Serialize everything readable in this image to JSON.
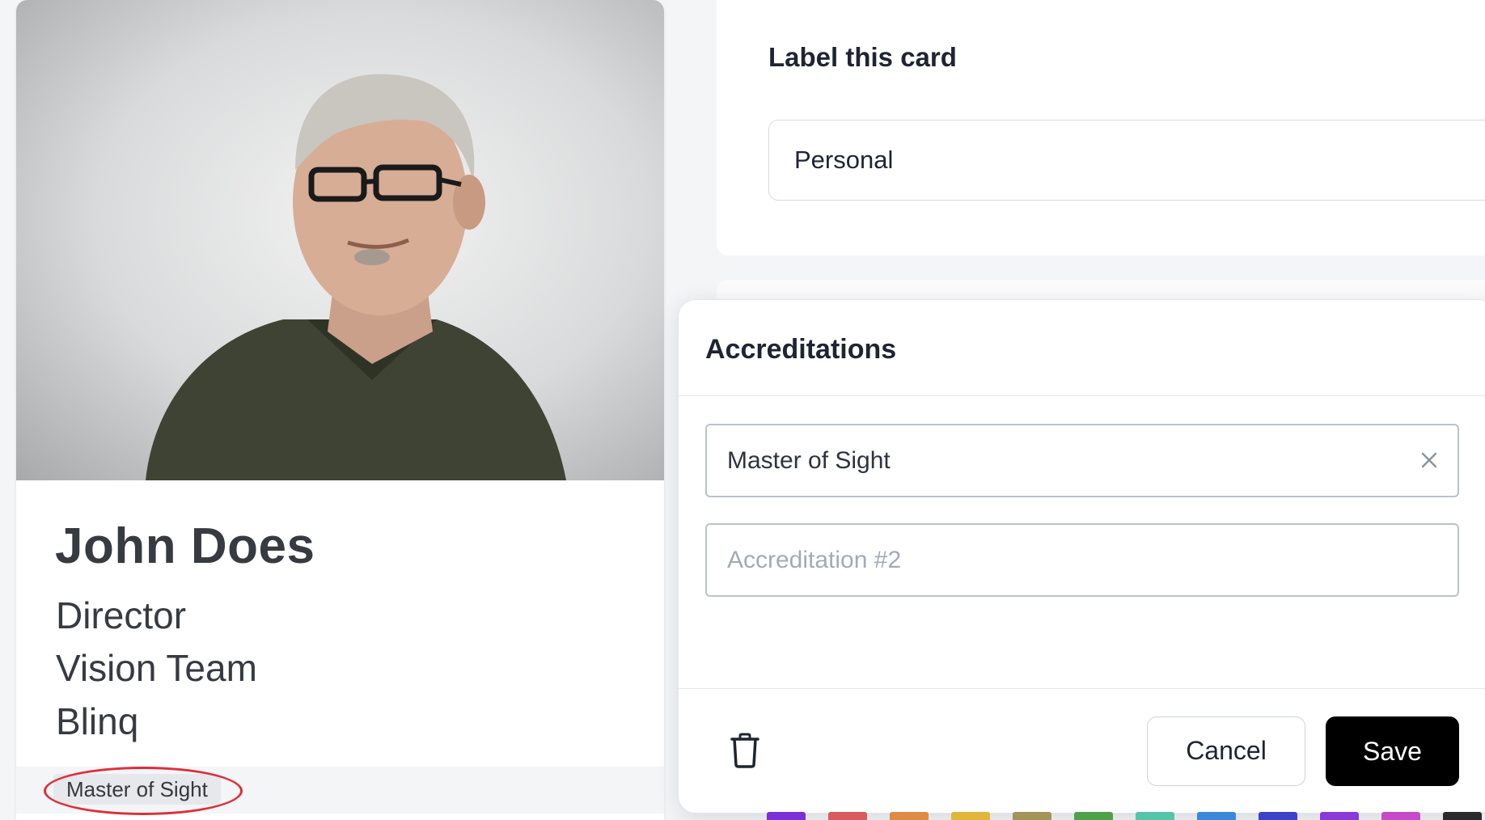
{
  "profile": {
    "name": "John Does",
    "title": "Director",
    "department": "Vision Team",
    "company": "Blinq",
    "badge": "Master of Sight"
  },
  "label_section": {
    "title": "Label this card",
    "value": "Personal"
  },
  "modal": {
    "title": "Accreditations",
    "field1_value": "Master of Sight",
    "field2_placeholder": "Accreditation #2",
    "cancel_label": "Cancel",
    "save_label": "Save"
  },
  "colors": {
    "highlight_ring": "#dc2f3a",
    "save_button": "#000000",
    "swatches": [
      "#7b2fd6",
      "#d95a5f",
      "#e08a47",
      "#e2b53b",
      "#a39457",
      "#4ea24a",
      "#56c4a8",
      "#3b87d9",
      "#3c43c9",
      "#8a3ad6",
      "#c74bc9",
      "#2b2b2b"
    ]
  }
}
